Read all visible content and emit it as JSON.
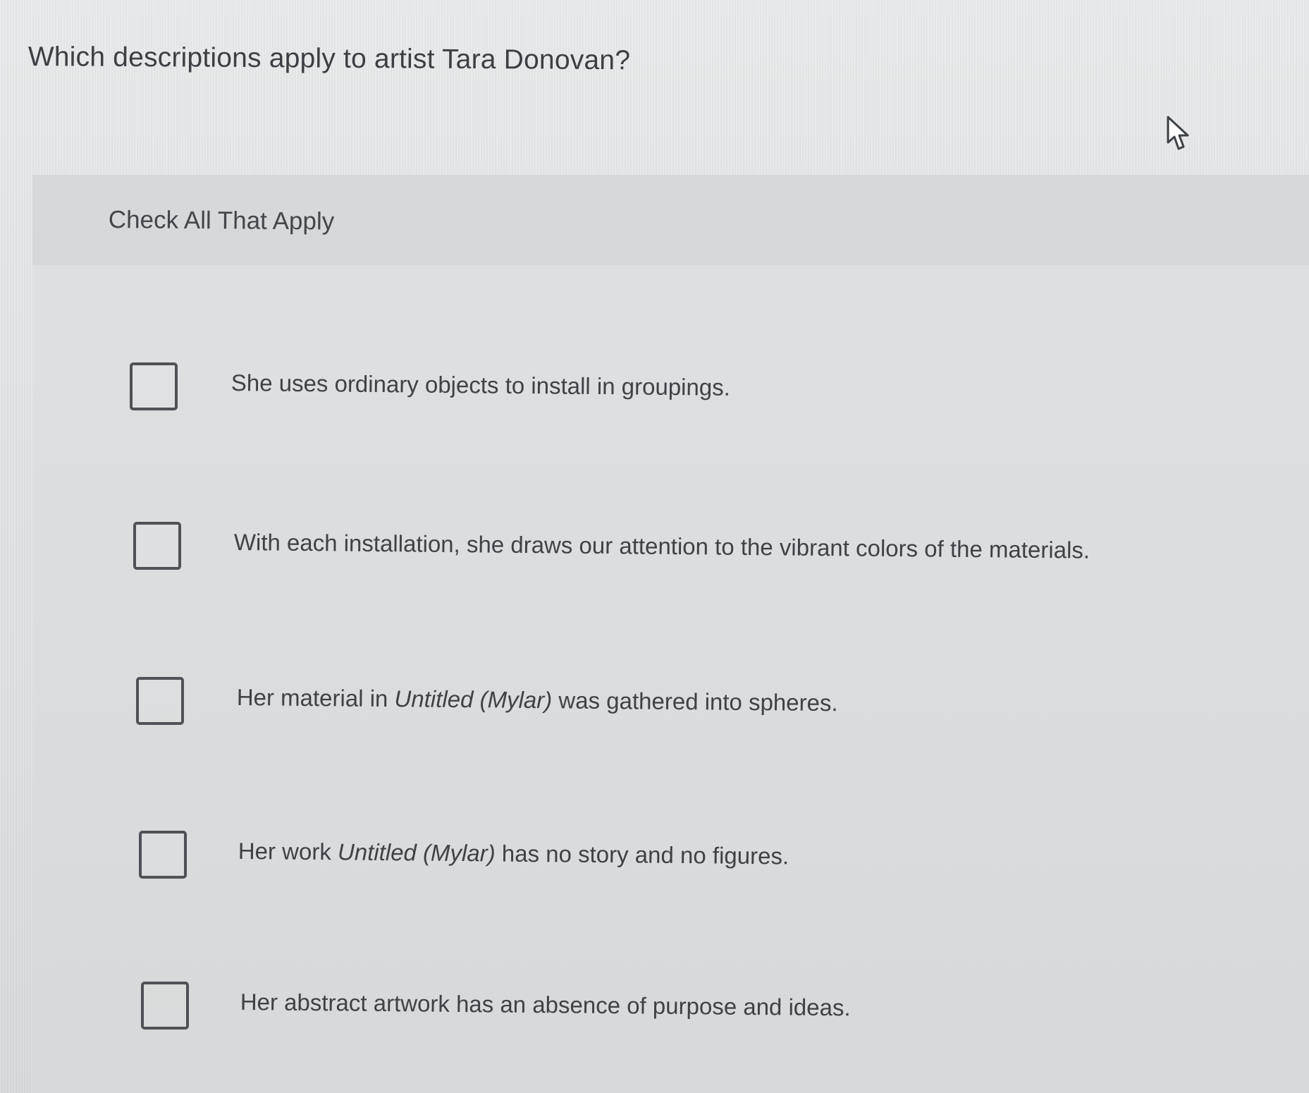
{
  "question": {
    "text": "Which descriptions apply to artist Tara Donovan?"
  },
  "instructions": {
    "label": "Check All That Apply"
  },
  "options": [
    {
      "prefix": "She uses ordinary objects to install in groupings.",
      "italic": "",
      "suffix": ""
    },
    {
      "prefix": "With each installation, she draws our attention to the vibrant colors of the materials.",
      "italic": "",
      "suffix": ""
    },
    {
      "prefix": "Her material in ",
      "italic": "Untitled (Mylar)",
      "suffix": " was gathered into spheres."
    },
    {
      "prefix": "Her work ",
      "italic": "Untitled (Mylar)",
      "suffix": " has no story and no figures."
    },
    {
      "prefix": "Her abstract artwork has an absence of purpose and ideas.",
      "italic": "",
      "suffix": ""
    }
  ],
  "icons": {
    "cursor": "mouse-pointer-icon"
  },
  "colors": {
    "background": "#dde1e1",
    "panel": "#d9dddd",
    "text": "#3e4246",
    "checkbox_border": "#4d5257"
  }
}
